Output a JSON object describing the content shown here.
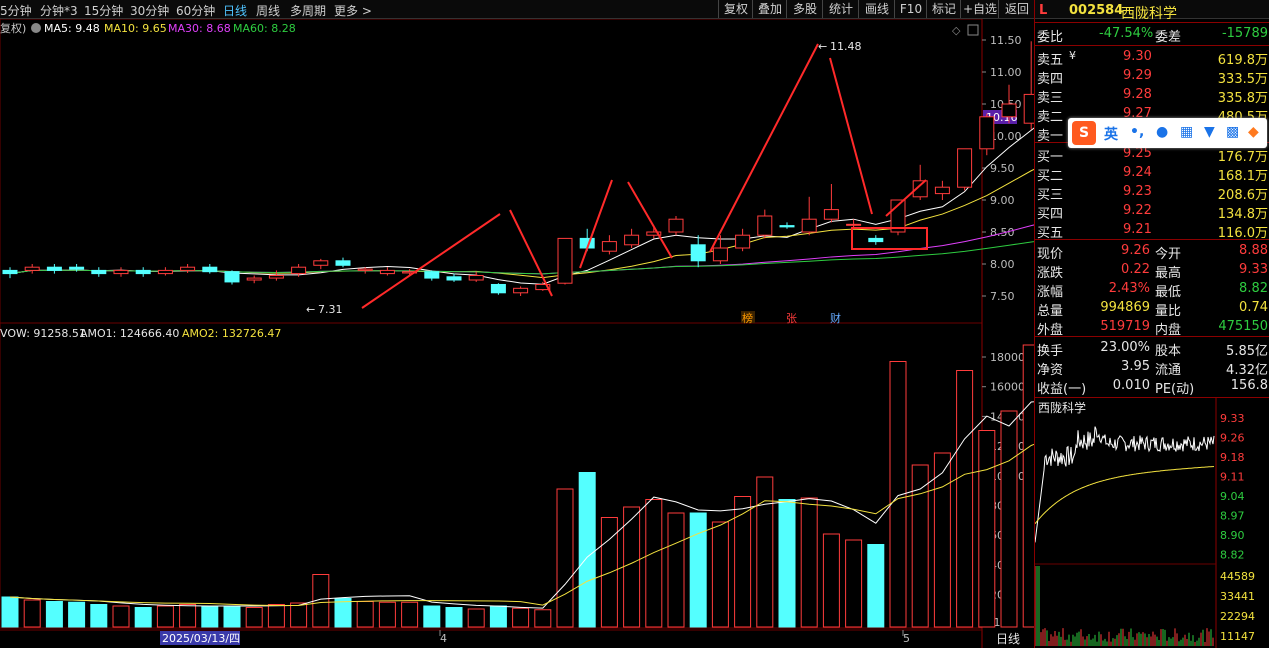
{
  "toolbar": {
    "periods": [
      "5分钟",
      "分钟*3",
      "15分钟",
      "30分钟",
      "60分钟",
      "日线",
      "周线",
      "多周期",
      "更多 >"
    ],
    "active_period": "日线",
    "buttons": [
      "复权",
      "叠加",
      "多股",
      "统计",
      "画线",
      "F10",
      "标记",
      "+自选",
      "返回"
    ]
  },
  "stock": {
    "flag": "L",
    "code": "002584",
    "name": "西陇科学"
  },
  "ma_legend": {
    "prefix": "复权)",
    "ma5": "MA5: 9.48",
    "ma10": "MA10: 9.65",
    "ma30": "MA30: 8.68",
    "ma60": "MA60: 8.28"
  },
  "vol_legend": {
    "vol": "VOW: 91258.51",
    "amo1": "AMO1: 124666.40",
    "amo2": "AMO2: 132726.47"
  },
  "price_axis": [
    "11.50",
    "11.00",
    "10.50",
    "10.00",
    "9.50",
    "9.00",
    "8.50",
    "8.00",
    "7.50"
  ],
  "price_marker": "10.16",
  "vol_axis": [
    "18000",
    "16000",
    "14000",
    "12000",
    "10000",
    "8000",
    "6000",
    "4000",
    "2000"
  ],
  "vol_unit": "X10",
  "annotations": {
    "high": "11.48",
    "low": "7.31"
  },
  "event_tags": [
    "榜",
    "张",
    "财"
  ],
  "date_axis": {
    "cursor_date": "2025/03/13/四",
    "month4": "4",
    "month5": "5",
    "period_label": "日线"
  },
  "colors": {
    "up": "#ff3c3c",
    "down": "#54ffff",
    "ma5": "#ffffff",
    "ma10": "#f3e23f",
    "ma30": "#e040fb",
    "ma60": "#2ecc40"
  },
  "orderbook": {
    "weibi_label": "委比",
    "weibi": "-47.54%",
    "weicha_label": "委差",
    "weicha": "-15789",
    "asks": [
      {
        "label": "卖五",
        "flag": "¥",
        "price": "9.30",
        "vol": "619.8万"
      },
      {
        "label": "卖四",
        "flag": "",
        "price": "9.29",
        "vol": "333.5万"
      },
      {
        "label": "卖三",
        "flag": "",
        "price": "9.28",
        "vol": "335.8万"
      },
      {
        "label": "卖二",
        "flag": "",
        "price": "9.27",
        "vol": "480.5万"
      },
      {
        "label": "卖一",
        "flag": "",
        "price": "",
        "vol": ""
      }
    ],
    "bids": [
      {
        "label": "买一",
        "price": "9.25",
        "vol": "176.7万"
      },
      {
        "label": "买二",
        "price": "9.24",
        "vol": "168.1万"
      },
      {
        "label": "买三",
        "price": "9.23",
        "vol": "208.6万"
      },
      {
        "label": "买四",
        "price": "9.22",
        "vol": "134.8万"
      },
      {
        "label": "买五",
        "price": "9.21",
        "vol": "116.0万"
      }
    ]
  },
  "quote": {
    "rows": [
      {
        "l1": "现价",
        "v1": "9.26",
        "l2": "今开",
        "v2": "8.88"
      },
      {
        "l1": "涨跌",
        "v1": "0.22",
        "l2": "最高",
        "v2": "9.33"
      },
      {
        "l1": "涨幅",
        "v1": "2.43%",
        "l2": "最低",
        "v2": "8.82"
      },
      {
        "l1": "总量",
        "v1": "994869",
        "l2": "量比",
        "v2": "0.74"
      },
      {
        "l1": "外盘",
        "v1": "519719",
        "l2": "内盘",
        "v2": "475150"
      }
    ]
  },
  "fundamentals": {
    "rows": [
      {
        "l1": "换手",
        "v1": "23.00%",
        "l2": "股本",
        "v2": "5.85亿"
      },
      {
        "l1": "净资",
        "v1": "3.95",
        "l2": "流通",
        "v2": "4.32亿"
      },
      {
        "l1": "收益(一)",
        "v1": "0.010",
        "l2": "PE(动)",
        "v2": "156.8"
      }
    ]
  },
  "mini_chart": {
    "title": "西陇科学",
    "price_labels": [
      "9.33",
      "9.26",
      "9.18",
      "9.11",
      "9.04",
      "8.97",
      "8.90",
      "8.82"
    ],
    "vol_labels": [
      "44589",
      "33441",
      "22294",
      "11147"
    ]
  },
  "ime": {
    "lang": "英",
    "punct": "•,"
  }
}
